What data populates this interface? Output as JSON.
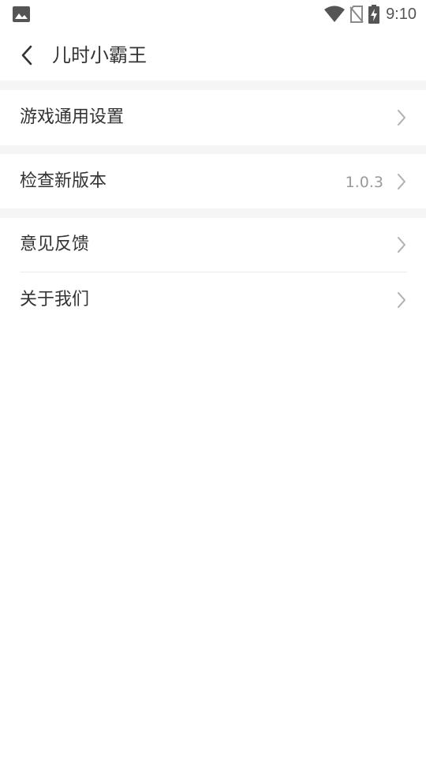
{
  "status_bar": {
    "time": "9:10",
    "left_icon": "image-icon",
    "right_icons": [
      "wifi-icon",
      "no-sim-icon",
      "battery-charging-icon"
    ]
  },
  "header": {
    "title": "儿时小霸王",
    "back_icon": "chevron-left-icon"
  },
  "settings": {
    "game_settings": {
      "label": "游戏通用设置"
    },
    "check_update": {
      "label": "检查新版本",
      "value": "1.0.3"
    },
    "feedback": {
      "label": "意见反馈"
    },
    "about": {
      "label": "关于我们"
    }
  },
  "colors": {
    "background": "#ffffff",
    "section_gap": "#f5f5f5",
    "text": "#333333",
    "secondary_text": "#9a9a9a",
    "chevron": "#b0b0b0"
  }
}
